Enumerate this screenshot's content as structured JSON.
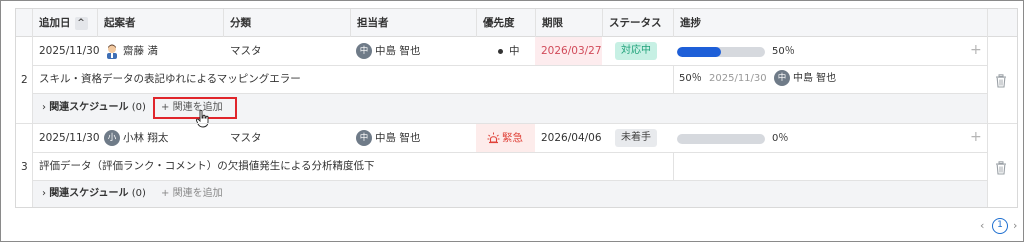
{
  "headers": {
    "date_added": "追加日",
    "sort_icon": "^",
    "creator": "起案者",
    "category": "分類",
    "assignee": "担当者",
    "priority": "優先度",
    "deadline": "期限",
    "status": "ステータス",
    "progress": "進捗"
  },
  "rows": [
    {
      "number": "2",
      "date_added": "2025/11/30",
      "creator_name": "齋藤 満",
      "category": "マスタ",
      "assignee_initial": "中",
      "assignee_name": "中島 智也",
      "priority": "中",
      "deadline": "2026/03/27",
      "status": "対応中",
      "progress_percent": 50,
      "progress_text": "50％",
      "description": "スキル・資格データの表記ゆれによるマッピングエラー",
      "latest_progress_percent": "50％",
      "latest_progress_date": "2025/11/30",
      "latest_assignee_initial": "中",
      "latest_assignee_name": "中島 智也",
      "related_label": "関連スケジュール",
      "related_count": "(0)",
      "add_related": "関連を追加"
    },
    {
      "number": "3",
      "date_added": "2025/11/30",
      "creator_initial": "小",
      "creator_name": "小林 翔太",
      "category": "マスタ",
      "assignee_initial": "中",
      "assignee_name": "中島 智也",
      "priority": "緊急",
      "deadline": "2026/04/06",
      "status": "未着手",
      "progress_percent": 0,
      "progress_text": "0％",
      "description": "評価データ（評価ランク・コメント）の欠損値発生による分析精度低下",
      "related_label": "関連スケジュール",
      "related_count": "(0)",
      "add_related": "関連を追加"
    }
  ],
  "pagination": {
    "prev": "‹",
    "current_page": "1",
    "next": "›"
  },
  "icons": {
    "chevron_right": "›",
    "plus": "+",
    "add_plus": "+"
  },
  "colors": {
    "progress_fill": "#1e5fd8",
    "progress_track": "#d6d9de",
    "status_in_progress_bg": "#c7f0e4",
    "status_not_started_bg": "#e8eaed",
    "urgent": "#e0433a",
    "deadline_overdue": "#d14b5a",
    "highlight_box": "#e0252b",
    "page_active": "#1e6fd0"
  }
}
